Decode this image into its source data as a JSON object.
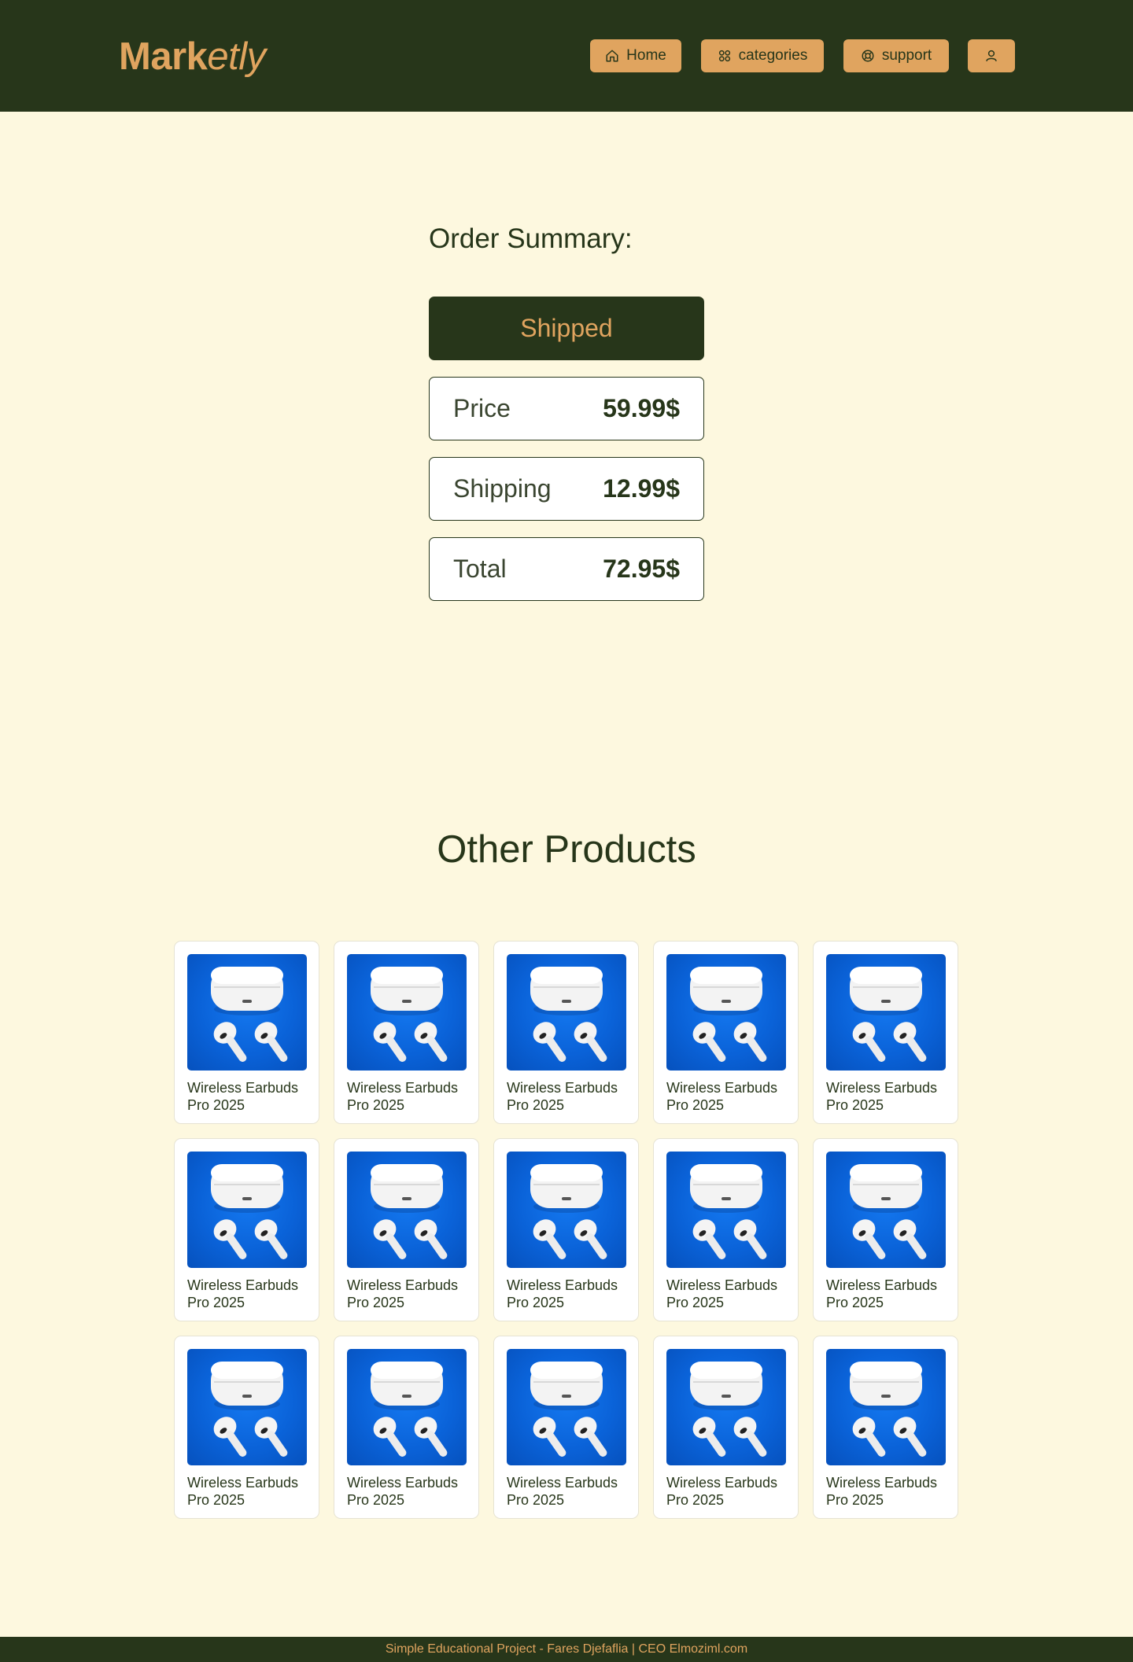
{
  "brand": {
    "bold": "Mark",
    "italic": "etly"
  },
  "nav": {
    "home": "Home",
    "categories": "categories",
    "support": "support"
  },
  "order": {
    "title": "Order Summary:",
    "status": "Shipped",
    "rows": [
      {
        "label": "Price",
        "value": "59.99$"
      },
      {
        "label": "Shipping",
        "value": "12.99$"
      },
      {
        "label": "Total",
        "value": "72.95$"
      }
    ]
  },
  "other_products": {
    "title": "Other Products",
    "items": [
      {
        "name": "Wireless Earbuds Pro 2025"
      },
      {
        "name": "Wireless Earbuds Pro 2025"
      },
      {
        "name": "Wireless Earbuds Pro 2025"
      },
      {
        "name": "Wireless Earbuds Pro 2025"
      },
      {
        "name": "Wireless Earbuds Pro 2025"
      },
      {
        "name": "Wireless Earbuds Pro 2025"
      },
      {
        "name": "Wireless Earbuds Pro 2025"
      },
      {
        "name": "Wireless Earbuds Pro 2025"
      },
      {
        "name": "Wireless Earbuds Pro 2025"
      },
      {
        "name": "Wireless Earbuds Pro 2025"
      },
      {
        "name": "Wireless Earbuds Pro 2025"
      },
      {
        "name": "Wireless Earbuds Pro 2025"
      },
      {
        "name": "Wireless Earbuds Pro 2025"
      },
      {
        "name": "Wireless Earbuds Pro 2025"
      },
      {
        "name": "Wireless Earbuds Pro 2025"
      }
    ]
  },
  "footer": {
    "text": "Simple Educational Project - Fares Djefaflia | CEO Elmoziml.com"
  },
  "colors": {
    "dark": "#27361a",
    "accent": "#e0a45f",
    "background": "#fdf8df"
  },
  "icons": {
    "home": "home-icon",
    "categories": "grid-icon",
    "support": "lifebuoy-icon",
    "account": "user-icon"
  }
}
